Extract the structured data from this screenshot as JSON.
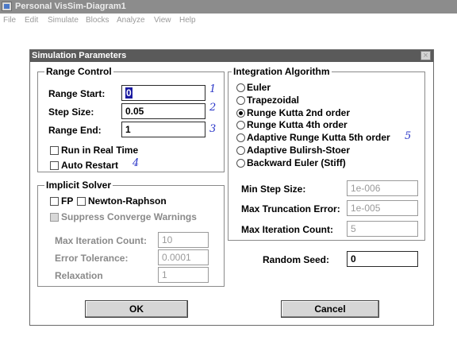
{
  "window": {
    "title": "Personal VisSim-Diagram1"
  },
  "menu": [
    "File",
    "Edit",
    "Simulate",
    "Blocks",
    "Analyze",
    "View",
    "Help"
  ],
  "dialog": {
    "title": "Simulation Parameters",
    "close_glyph": "×",
    "range_control": {
      "legend": "Range Control",
      "range_start_label": "Range Start:",
      "range_start_value": "0",
      "step_size_label": "Step Size:",
      "step_size_value": "0.05",
      "range_end_label": "Range End:",
      "range_end_value": "1",
      "run_real_time_label": "Run in Real Time",
      "run_real_time_checked": false,
      "auto_restart_label": "Auto Restart",
      "auto_restart_checked": false
    },
    "implicit_solver": {
      "legend": "Implicit Solver",
      "fp_label": "FP",
      "fp_checked": false,
      "newton_label": "Newton-Raphson",
      "newton_checked": false,
      "suppress_label": "Suppress Converge Warnings",
      "max_iter_label": "Max Iteration Count:",
      "max_iter_value": "10",
      "error_tol_label": "Error Tolerance:",
      "error_tol_value": "0.0001",
      "relaxation_label": "Relaxation",
      "relaxation_value": "1"
    },
    "integration": {
      "legend": "Integration Algorithm",
      "options": [
        "Euler",
        "Trapezoidal",
        "Runge Kutta 2nd order",
        "Runge Kutta 4th order",
        "Adaptive Runge Kutta 5th order",
        "Adaptive Bulirsh-Stoer",
        "Backward Euler (Stiff)"
      ],
      "selected": "Runge Kutta 2nd order",
      "min_step_label": "Min Step Size:",
      "min_step_value": "1e-006",
      "max_trunc_label": "Max Truncation Error:",
      "max_trunc_value": "1e-005",
      "max_iter_label": "Max Iteration Count:",
      "max_iter_value": "5"
    },
    "random_seed_label": "Random Seed:",
    "random_seed_value": "0",
    "ok_label": "OK",
    "cancel_label": "Cancel"
  },
  "annotations": [
    "1",
    "2",
    "3",
    "4",
    "5"
  ],
  "colors": {
    "titlebar": "#8c8c8c",
    "dialog_titlebar": "#5a5a5a",
    "annotation": "#2a36c8",
    "disabled_text": "#8a8a8a"
  }
}
